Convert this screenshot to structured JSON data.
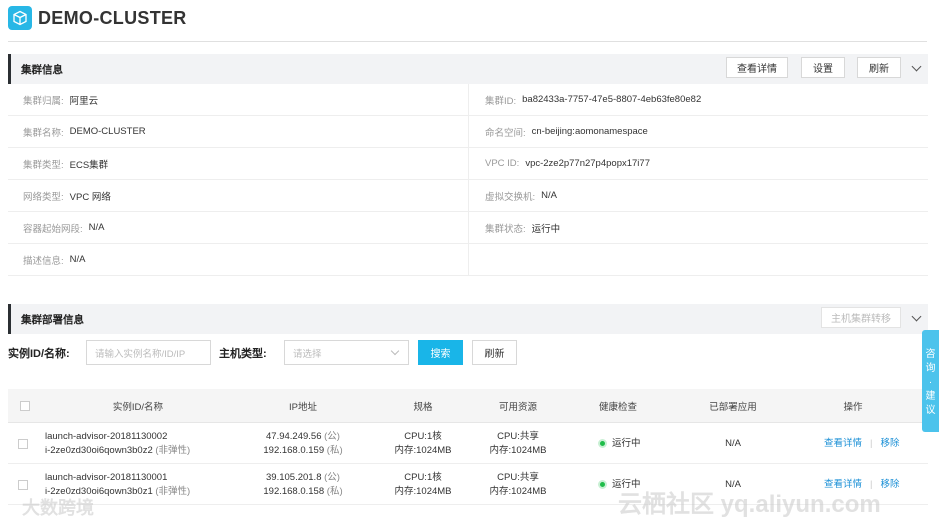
{
  "header": {
    "title": "DEMO-CLUSTER",
    "logo_icon": "cube-icon"
  },
  "cluster_info": {
    "title": "集群信息",
    "buttons": {
      "details": "查看详情",
      "settings": "设置",
      "refresh": "刷新"
    },
    "rows": [
      {
        "k1": "集群归属:",
        "v1": "阿里云",
        "k2": "集群ID:",
        "v2": "ba82433a-7757-47e5-8807-4eb63fe80e82"
      },
      {
        "k1": "集群名称:",
        "v1": "DEMO-CLUSTER",
        "k2": "命名空间:",
        "v2": "cn-beijing:aomonamespace"
      },
      {
        "k1": "集群类型:",
        "v1": "ECS集群",
        "k2": "VPC ID:",
        "v2": "vpc-2ze2p77n27p4popx17i77"
      },
      {
        "k1": "网络类型:",
        "v1": "VPC 网络",
        "k2": "虚拟交换机:",
        "v2": "N/A"
      },
      {
        "k1": "容器起始网段:",
        "v1": "N/A",
        "k2": "集群状态:",
        "v2": "运行中"
      },
      {
        "k1": "描述信息:",
        "v1": "N/A"
      }
    ]
  },
  "deploy_info": {
    "title": "集群部署信息",
    "migrate_button": "主机集群转移",
    "filters": {
      "instance_label": "实例ID/名称:",
      "instance_placeholder": "请输入实例名称/ID/IP",
      "host_type_label": "主机类型:",
      "host_type_placeholder": "请选择",
      "search": "搜索",
      "refresh": "刷新"
    },
    "columns": [
      "实例ID/名称",
      "IP地址",
      "规格",
      "可用资源",
      "健康检查",
      "已部署应用",
      "操作"
    ],
    "rows": [
      {
        "name": "launch-advisor-20181130002",
        "id": "i-2ze0zd30oi6qown3b0z2",
        "id_note": "(非弹性)",
        "ip_public": "47.94.249.56",
        "ip_public_note": "(公)",
        "ip_private": "192.168.0.159",
        "ip_private_note": "(私)",
        "spec_cpu": "CPU:1核",
        "spec_mem": "内存:1024MB",
        "res_cpu": "CPU:共享",
        "res_mem": "内存:1024MB",
        "health": "运行中",
        "apps": "N/A",
        "action_view": "查看详情",
        "action_remove": "移除"
      },
      {
        "name": "launch-advisor-20181130001",
        "id": "i-2ze0zd30oi6qown3b0z1",
        "id_note": "(非弹性)",
        "ip_public": "39.105.201.8",
        "ip_public_note": "(公)",
        "ip_private": "192.168.0.158",
        "ip_private_note": "(私)",
        "spec_cpu": "CPU:1核",
        "spec_mem": "内存:1024MB",
        "res_cpu": "CPU:共享",
        "res_mem": "内存:1024MB",
        "health": "运行中",
        "apps": "N/A",
        "action_view": "查看详情",
        "action_remove": "移除"
      }
    ]
  },
  "float_tab": {
    "chars": [
      "咨",
      "询",
      "·",
      "建",
      "议"
    ]
  },
  "watermarks": {
    "left": "大数跨境",
    "right": "云栖社区 yq.aliyun.com"
  },
  "colors": {
    "accent": "#19b5e8",
    "link": "#1a8fd6",
    "status_ok": "#1fbd4a"
  }
}
